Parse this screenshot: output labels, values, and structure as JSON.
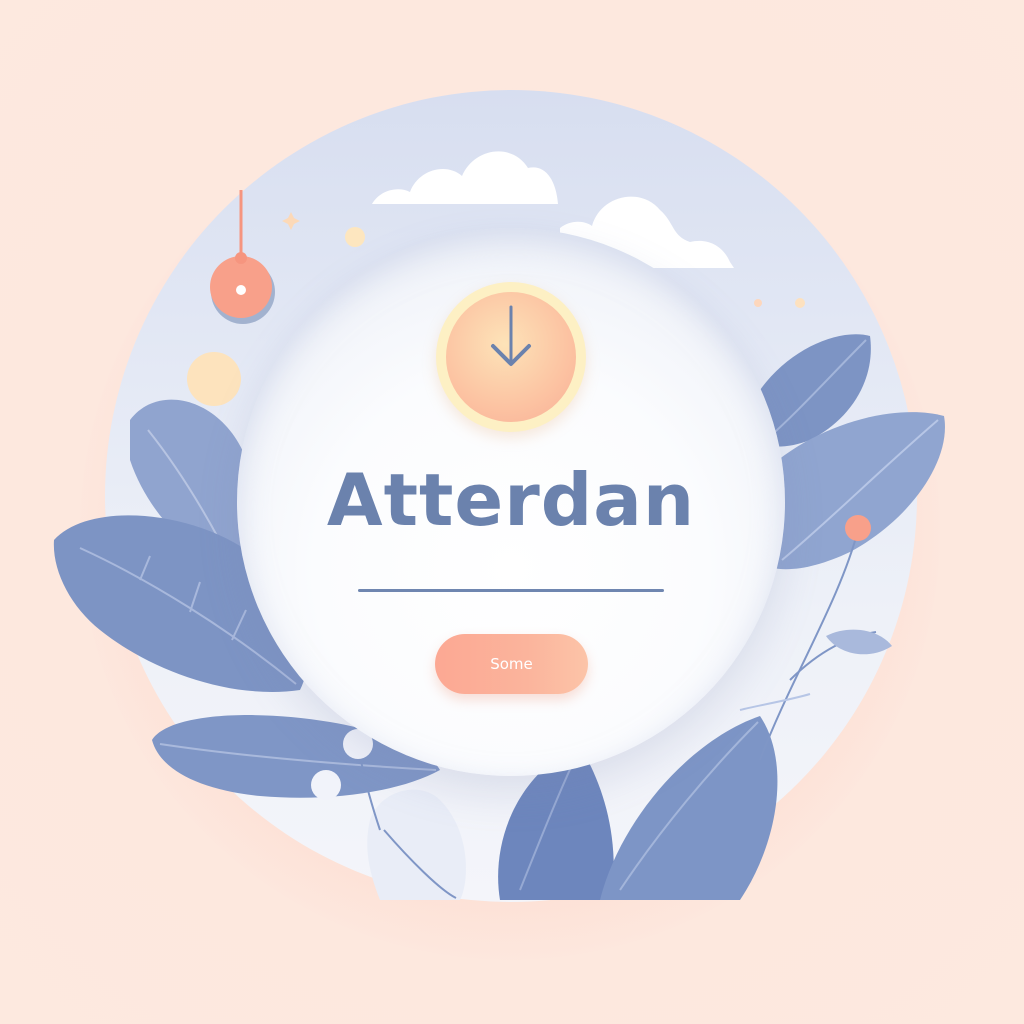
{
  "title": "Atterdan",
  "action_button": {
    "label": "Some"
  },
  "colors": {
    "background": "#fde6dc",
    "accent_blue": "#6b82ad",
    "accent_peach": "#fca893",
    "card": "#ffffff"
  },
  "icons": {
    "clock": "clock-icon",
    "arrow": "down-arrow-icon",
    "pendant": "pendant-icon",
    "cloud": "cloud-icon",
    "leaf": "leaf-icon"
  }
}
